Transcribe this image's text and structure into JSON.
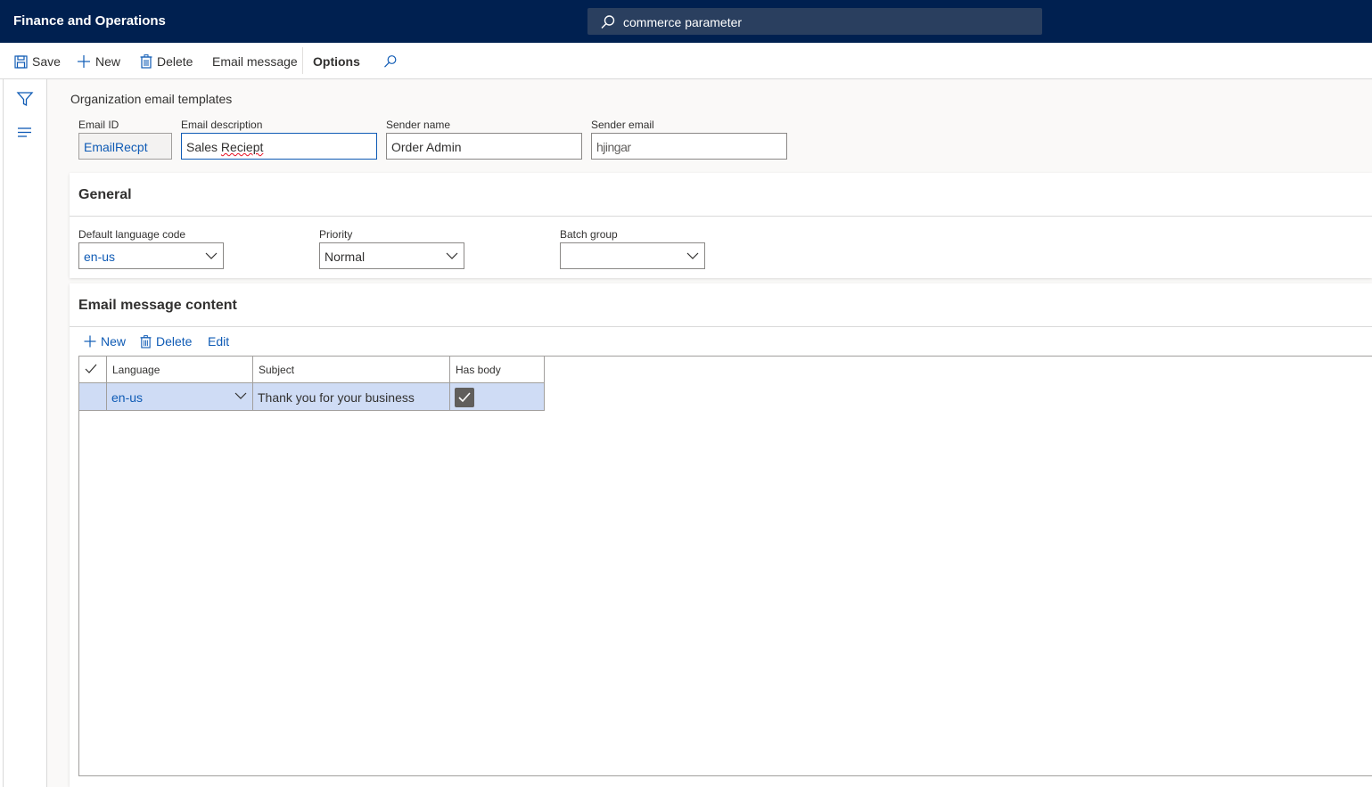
{
  "app": {
    "title": "Finance and Operations"
  },
  "search": {
    "value": "commerce parameter"
  },
  "actions": {
    "save": "Save",
    "new": "New",
    "delete": "Delete",
    "email_message": "Email message",
    "options": "Options"
  },
  "page": {
    "caption": "Organization email templates"
  },
  "header_fields": {
    "email_id": {
      "label": "Email ID",
      "value": "EmailRecpt"
    },
    "email_description": {
      "label": "Email description",
      "value_prefix": "Sales ",
      "value_misspelled": "Reciept"
    },
    "sender_name": {
      "label": "Sender name",
      "value": "Order Admin"
    },
    "sender_email": {
      "label": "Sender email",
      "value": "hjingar"
    }
  },
  "general": {
    "title": "General",
    "default_language": {
      "label": "Default language code",
      "value": "en-us"
    },
    "priority": {
      "label": "Priority",
      "value": "Normal"
    },
    "batch_group": {
      "label": "Batch group",
      "value": ""
    }
  },
  "content": {
    "title": "Email message content",
    "actions": {
      "new": "New",
      "delete": "Delete",
      "edit": "Edit"
    },
    "columns": {
      "language": "Language",
      "subject": "Subject",
      "has_body": "Has body"
    },
    "rows": [
      {
        "language": "en-us",
        "subject": "Thank you for your business",
        "has_body": true
      }
    ]
  },
  "colors": {
    "topbar": "#002050",
    "accent": "#0f5bb5",
    "selected_row": "#cfdcf5"
  }
}
